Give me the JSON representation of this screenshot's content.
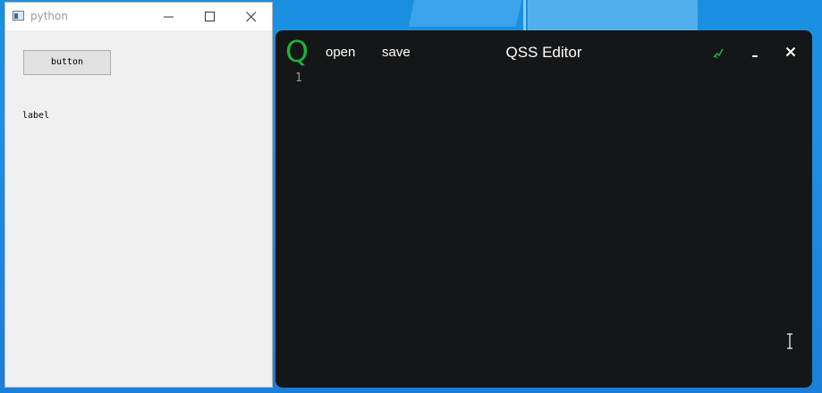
{
  "python_window": {
    "title": "python",
    "app_icon": "window-icon",
    "controls": [
      "minimize-icon",
      "maximize-icon",
      "close-icon"
    ],
    "button_label": "button",
    "label_text": "label"
  },
  "qss_editor": {
    "logo": "Q",
    "menu": {
      "open_label": "open",
      "save_label": "save"
    },
    "title": "QSS Editor",
    "pin_icon": "pin-icon",
    "line_numbers": [
      "1"
    ],
    "colors": {
      "accent": "#20b13a",
      "background": "#151617",
      "text": "#ffffff",
      "line_number": "#9a9a9a"
    }
  },
  "desktop": {
    "background_color": "#1a8fe0"
  }
}
